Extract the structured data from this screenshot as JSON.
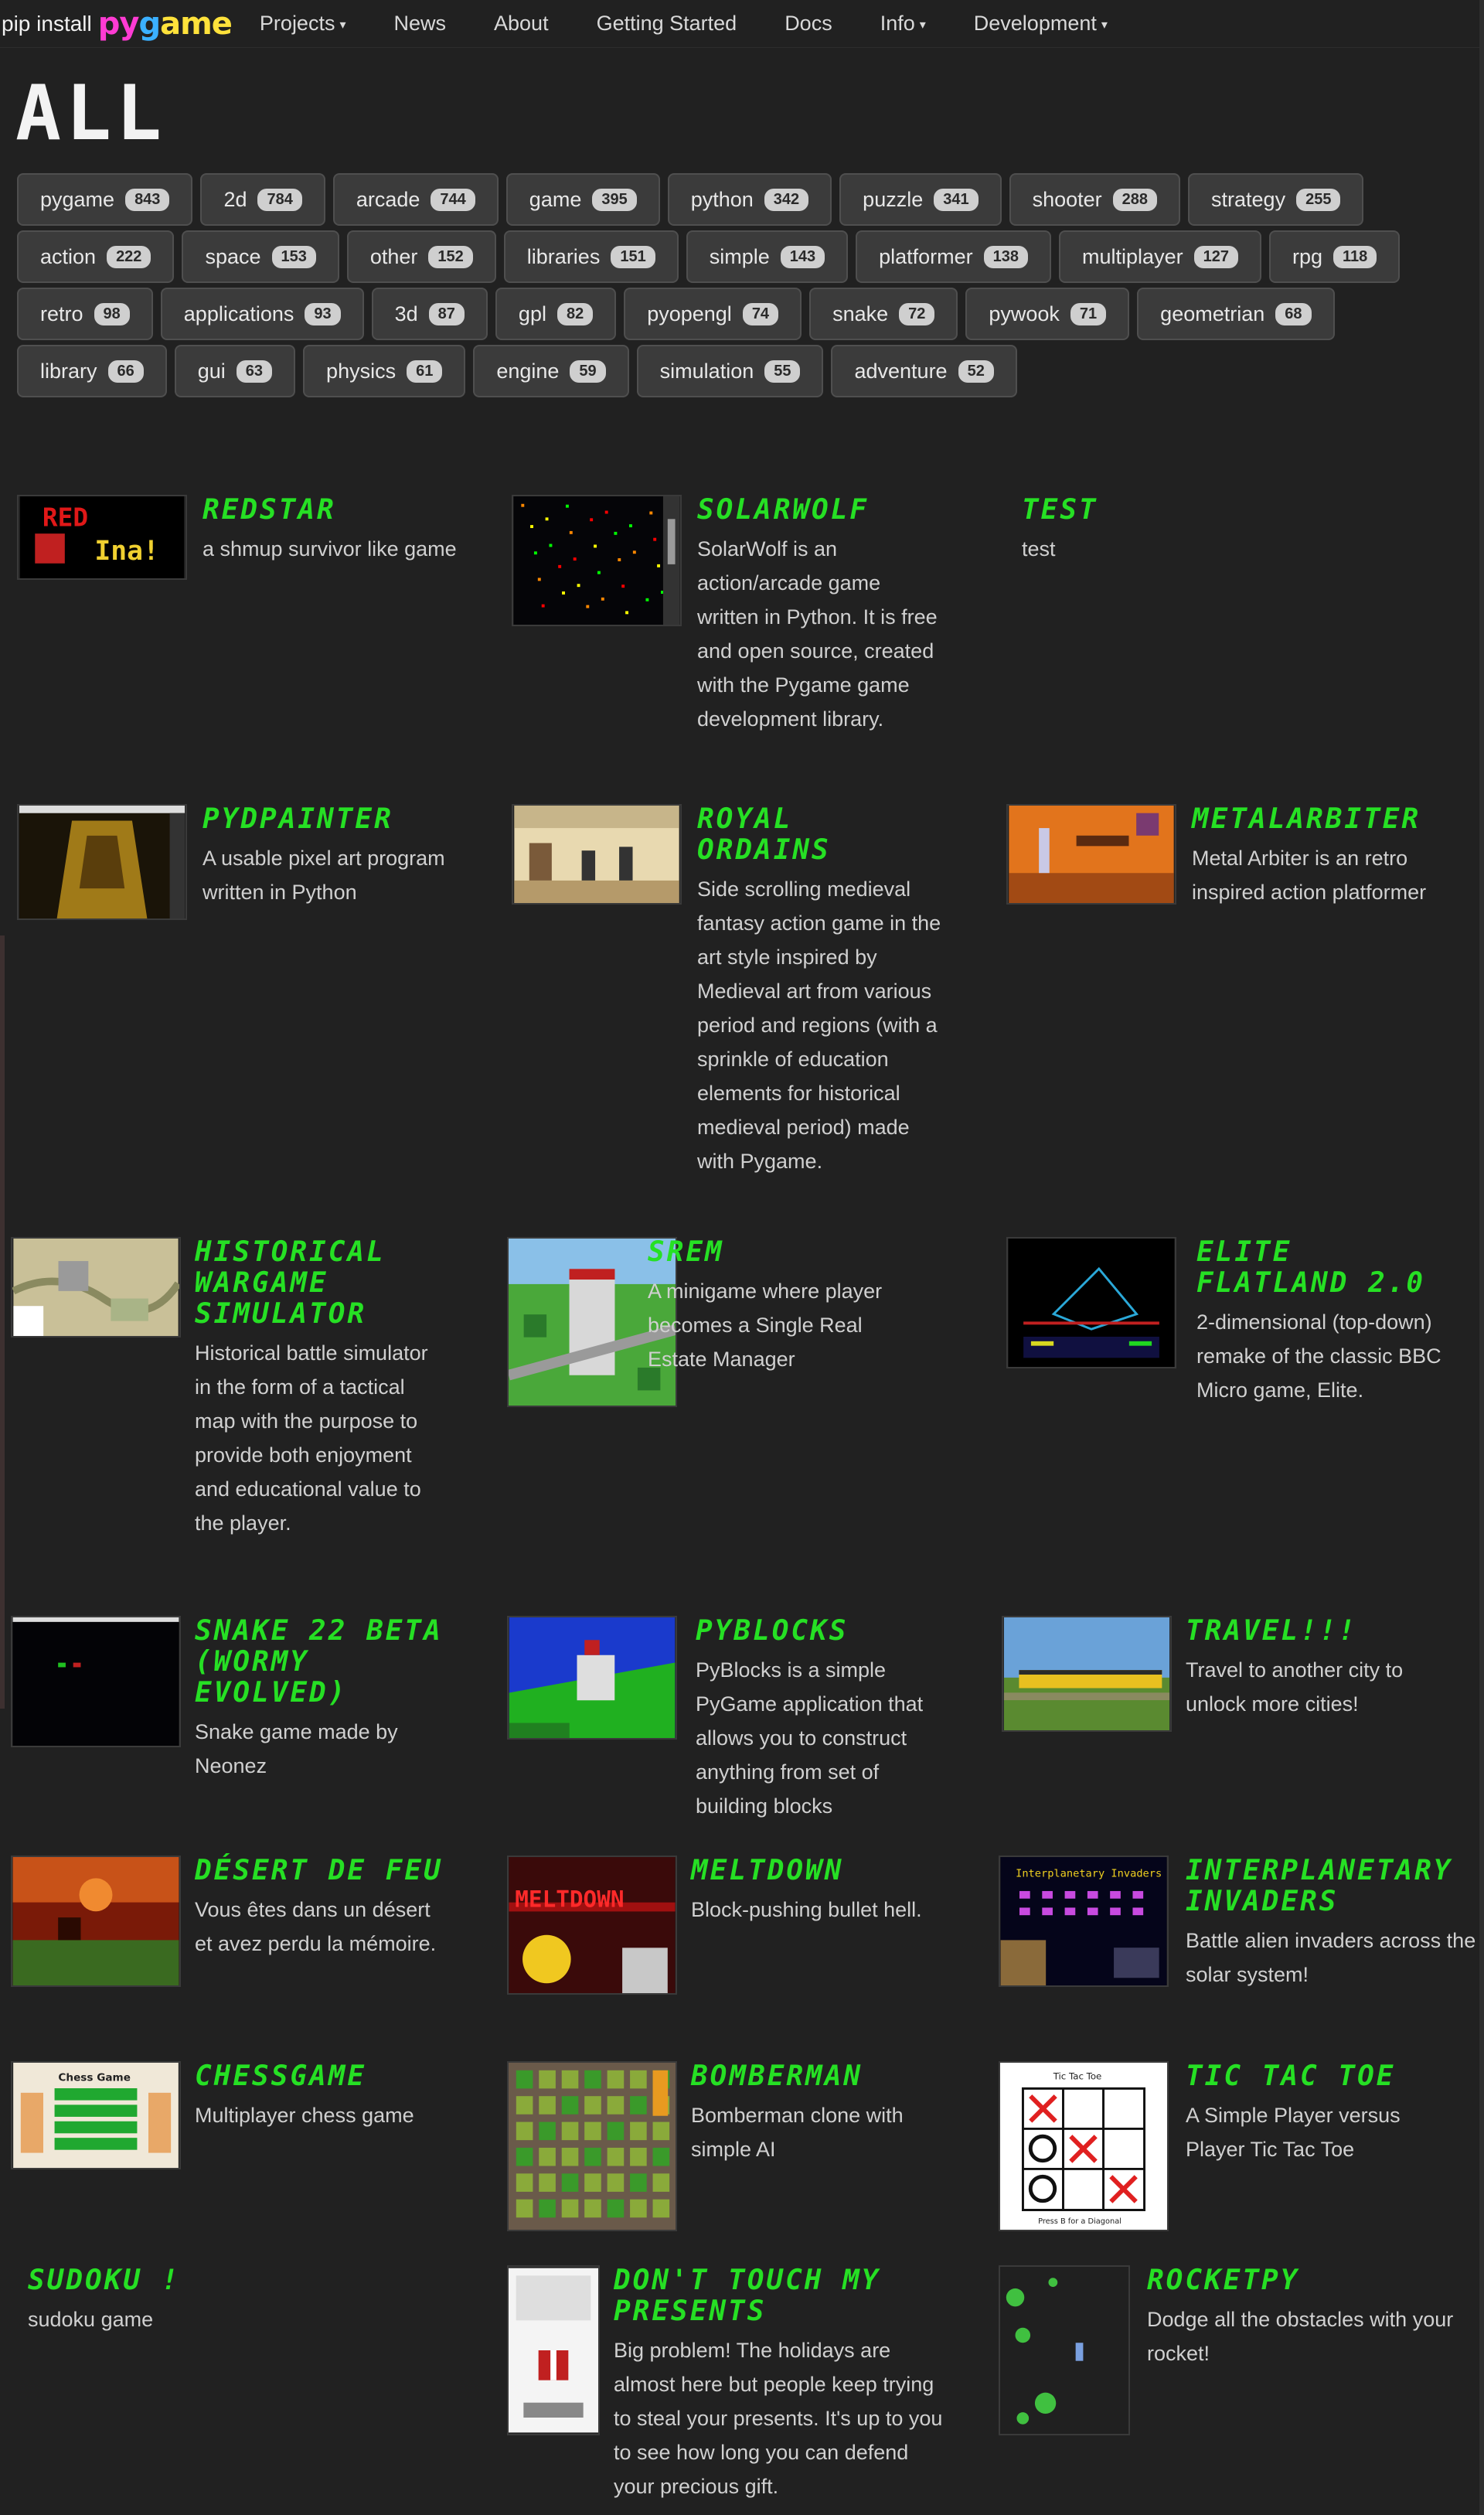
{
  "navbar": {
    "pip_label": "pip install",
    "logo_text": "pygame",
    "items": [
      {
        "label": "Projects",
        "dropdown": true
      },
      {
        "label": "News",
        "dropdown": false
      },
      {
        "label": "About",
        "dropdown": false
      },
      {
        "label": "Getting Started",
        "dropdown": false
      },
      {
        "label": "Docs",
        "dropdown": false
      },
      {
        "label": "Info",
        "dropdown": true
      },
      {
        "label": "Development",
        "dropdown": true
      }
    ]
  },
  "page": {
    "title": "ALL"
  },
  "tags": [
    {
      "label": "pygame",
      "count": "843"
    },
    {
      "label": "2d",
      "count": "784"
    },
    {
      "label": "arcade",
      "count": "744"
    },
    {
      "label": "game",
      "count": "395"
    },
    {
      "label": "python",
      "count": "342"
    },
    {
      "label": "puzzle",
      "count": "341"
    },
    {
      "label": "shooter",
      "count": "288"
    },
    {
      "label": "strategy",
      "count": "255"
    },
    {
      "label": "action",
      "count": "222"
    },
    {
      "label": "space",
      "count": "153"
    },
    {
      "label": "other",
      "count": "152"
    },
    {
      "label": "libraries",
      "count": "151"
    },
    {
      "label": "simple",
      "count": "143"
    },
    {
      "label": "platformer",
      "count": "138"
    },
    {
      "label": "multiplayer",
      "count": "127"
    },
    {
      "label": "rpg",
      "count": "118"
    },
    {
      "label": "retro",
      "count": "98"
    },
    {
      "label": "applications",
      "count": "93"
    },
    {
      "label": "3d",
      "count": "87"
    },
    {
      "label": "gpl",
      "count": "82"
    },
    {
      "label": "pyopengl",
      "count": "74"
    },
    {
      "label": "snake",
      "count": "72"
    },
    {
      "label": "pywook",
      "count": "71"
    },
    {
      "label": "geometrian",
      "count": "68"
    },
    {
      "label": "library",
      "count": "66"
    },
    {
      "label": "gui",
      "count": "63"
    },
    {
      "label": "physics",
      "count": "61"
    },
    {
      "label": "engine",
      "count": "59"
    },
    {
      "label": "simulation",
      "count": "55"
    },
    {
      "label": "adventure",
      "count": "52"
    }
  ],
  "projects": [
    {
      "title": "REDSTAR",
      "desc": "a shmup survivor like game",
      "thumb": "redstar"
    },
    {
      "title": "SOLARWOLF",
      "desc": "SolarWolf is an action/arcade game written in Python. It is free and open source, created with the Pygame game development library.",
      "thumb": "solarwolf"
    },
    {
      "title": "TEST",
      "desc": "test",
      "thumb": ""
    },
    {
      "title": "PYDPAINTER",
      "desc": "A usable pixel art program written in Python",
      "thumb": "pydpainter"
    },
    {
      "title": "ROYAL ORDAINS",
      "desc": "Side scrolling medieval fantasy action game in the art style inspired by Medieval art from various period and regions (with a sprinkle of education elements for historical medieval period) made with Pygame.",
      "thumb": "royal"
    },
    {
      "title": "METALARBITER",
      "desc": "Metal Arbiter is an retro inspired action platformer",
      "thumb": "metal"
    },
    {
      "title": "HISTORICAL WARGAME SIMULATOR",
      "desc": "Historical battle simulator in the form of a tactical map with the purpose to provide both enjoyment and educational value to the player.",
      "thumb": "wargame"
    },
    {
      "title": "SREM",
      "desc": "A minigame where player becomes a Single Real Estate Manager",
      "thumb": "srem"
    },
    {
      "title": "ELITE FLATLAND 2.0",
      "desc": "2-dimensional (top-down) remake of the classic BBC Micro game, Elite.",
      "thumb": "elite"
    },
    {
      "title": "SNAKE 22 BETA (WORMY EVOLVED)",
      "desc": "Snake game made by Neonez",
      "thumb": "snake"
    },
    {
      "title": "PYBLOCKS",
      "desc": "PyBlocks is a simple PyGame application that allows you to construct anything from set of building blocks",
      "thumb": "pyblocks"
    },
    {
      "title": "TRAVEL!!!",
      "desc": "Travel to another city to unlock more cities!",
      "thumb": "travel"
    },
    {
      "title": "DéSERT DE FEU",
      "desc": "Vous êtes dans un désert et avez perdu la mémoire.",
      "thumb": "desert"
    },
    {
      "title": "MELTDOWN",
      "desc": "Block-pushing bullet hell.",
      "thumb": "meltdown"
    },
    {
      "title": "INTERPLANETARY INVADERS",
      "desc": "Battle alien invaders across the solar system!",
      "thumb": "invaders"
    },
    {
      "title": "CHESSGAME",
      "desc": "Multiplayer chess game",
      "thumb": "chess"
    },
    {
      "title": "BOMBERMAN",
      "desc": "Bomberman clone with simple AI",
      "thumb": "bomber"
    },
    {
      "title": "TIC TAC TOE",
      "desc": "A Simple Player versus Player Tic Tac Toe",
      "thumb": "ttt"
    },
    {
      "title": "SUDOKU !",
      "desc": "sudoku game",
      "thumb": ""
    },
    {
      "title": "DON'T TOUCH MY PRESENTS",
      "desc": "Big problem! The holidays are almost here but people keep trying to steal your presents. It's up to you to see how long you can defend your precious gift.",
      "thumb": "presents"
    },
    {
      "title": "ROCKETPY",
      "desc": "Dodge all the obstacles with your rocket!",
      "thumb": "rocket"
    }
  ],
  "thumb_texts": {
    "redstar_top": "RED",
    "redstar_bottom": "Ina!",
    "meltdown": "MELTDOWN",
    "chess": "Chess Game",
    "ttt_top": "Tic Tac Toe",
    "ttt_bottom": "Press B for a Diagonal",
    "invaders": "Interplanetary Invaders"
  }
}
